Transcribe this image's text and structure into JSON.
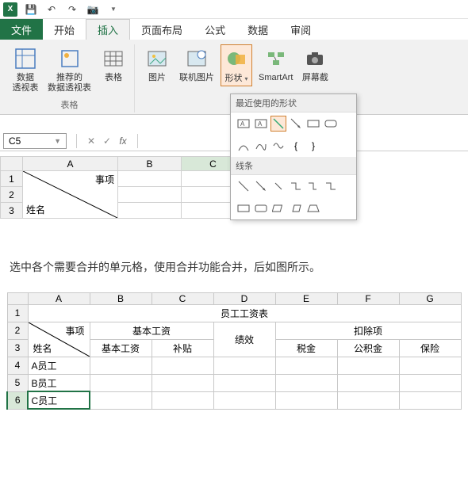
{
  "qat": {
    "save": "💾",
    "undo": "↶",
    "redo": "↷",
    "cam": "📷"
  },
  "tabs": {
    "file": "文件",
    "home": "开始",
    "insert": "插入",
    "layout": "页面布局",
    "formulas": "公式",
    "data": "数据",
    "review": "审阅"
  },
  "ribbon": {
    "pivottable": "数据\n透视表",
    "rec_pivot": "推荐的\n数据透视表",
    "tables": "表格",
    "group_tables": "表格",
    "pictures": "图片",
    "online_pic": "联机图片",
    "shapes": "形状",
    "smartart": "SmartArt",
    "screenshot": "屏幕截"
  },
  "gallery": {
    "recent": "最近使用的形状",
    "lines": "线条"
  },
  "formula_bar": {
    "namebox": "C5",
    "fx": "fx"
  },
  "sheet1": {
    "cols": [
      "A",
      "B",
      "C"
    ],
    "rows": [
      "1",
      "2",
      "3"
    ],
    "diag_top": "事项",
    "diag_bot": "姓名"
  },
  "instruction": "选中各个需要合并的单元格，使用合并功能合并，后如图所示。",
  "chart_data": {
    "type": "table",
    "cols": [
      "A",
      "B",
      "C",
      "D",
      "E",
      "F",
      "G"
    ],
    "rowhdr": [
      "1",
      "2",
      "3",
      "4",
      "5",
      "6"
    ],
    "title": "员工工资表",
    "diag_top": "事项",
    "diag_bot": "姓名",
    "hdr_basic": "基本工资",
    "hdr_perf": "绩效",
    "hdr_deduct": "扣除项",
    "sub_basic": "基本工资",
    "sub_allow": "补贴",
    "sub_tax": "税金",
    "sub_fund": "公积金",
    "sub_ins": "保险",
    "empA": "A员工",
    "empB": "B员工",
    "empC": "C员工"
  }
}
